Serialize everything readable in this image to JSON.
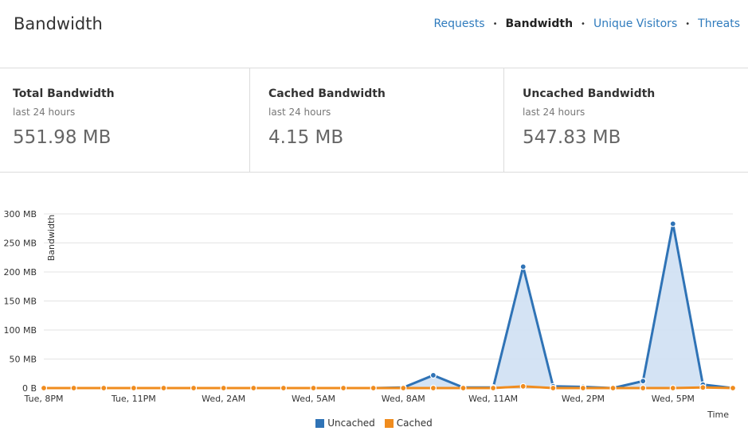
{
  "header": {
    "title": "Bandwidth",
    "nav": [
      {
        "label": "Requests",
        "active": false
      },
      {
        "label": "Bandwidth",
        "active": true
      },
      {
        "label": "Unique Visitors",
        "active": false
      },
      {
        "label": "Threats",
        "active": false
      }
    ],
    "separator": "•"
  },
  "stats": [
    {
      "title": "Total Bandwidth",
      "subtitle": "last 24 hours",
      "value": "551.98 MB"
    },
    {
      "title": "Cached Bandwidth",
      "subtitle": "last 24 hours",
      "value": "4.15 MB"
    },
    {
      "title": "Uncached Bandwidth",
      "subtitle": "last 24 hours",
      "value": "547.83 MB"
    }
  ],
  "colors": {
    "uncached": "#2f73b6",
    "uncached_fill": "#cfe0f3",
    "cached": "#f08c1e",
    "link": "#2f7bbd"
  },
  "chart_data": {
    "type": "area",
    "title": "",
    "xlabel": "Time",
    "ylabel": "Bandwidth",
    "ylim": [
      0,
      300
    ],
    "yticks": [
      "0 B",
      "50 MB",
      "100 MB",
      "150 MB",
      "200 MB",
      "250 MB",
      "300 MB"
    ],
    "yunit": "MB",
    "grid": true,
    "legend_position": "bottom-center",
    "x": [
      "Tue, 8PM",
      "Tue, 9PM",
      "Tue, 10PM",
      "Tue, 11PM",
      "Wed, 12AM",
      "Wed, 1AM",
      "Wed, 2AM",
      "Wed, 3AM",
      "Wed, 4AM",
      "Wed, 5AM",
      "Wed, 6AM",
      "Wed, 7AM",
      "Wed, 8AM",
      "Wed, 9AM",
      "Wed, 10AM",
      "Wed, 11AM",
      "Wed, 12PM",
      "Wed, 1PM",
      "Wed, 2PM",
      "Wed, 3PM",
      "Wed, 4PM",
      "Wed, 5PM",
      "Wed, 6PM",
      "Wed, 7PM"
    ],
    "xtick_labels": [
      "Tue, 8PM",
      "Tue, 11PM",
      "Wed, 2AM",
      "Wed, 5AM",
      "Wed, 8AM",
      "Wed, 11AM",
      "Wed, 2PM",
      "Wed, 5PM"
    ],
    "series": [
      {
        "name": "Uncached",
        "values": [
          0,
          0,
          0,
          0,
          0,
          0,
          0,
          0,
          0,
          0,
          0,
          0,
          1,
          22,
          1,
          1,
          209,
          3,
          2,
          0,
          12,
          283,
          6,
          0
        ]
      },
      {
        "name": "Cached",
        "values": [
          0,
          0,
          0,
          0,
          0,
          0,
          0,
          0,
          0,
          0,
          0,
          0,
          0,
          0,
          0,
          0,
          3,
          0,
          0,
          0,
          0,
          0,
          1,
          0
        ]
      }
    ]
  }
}
